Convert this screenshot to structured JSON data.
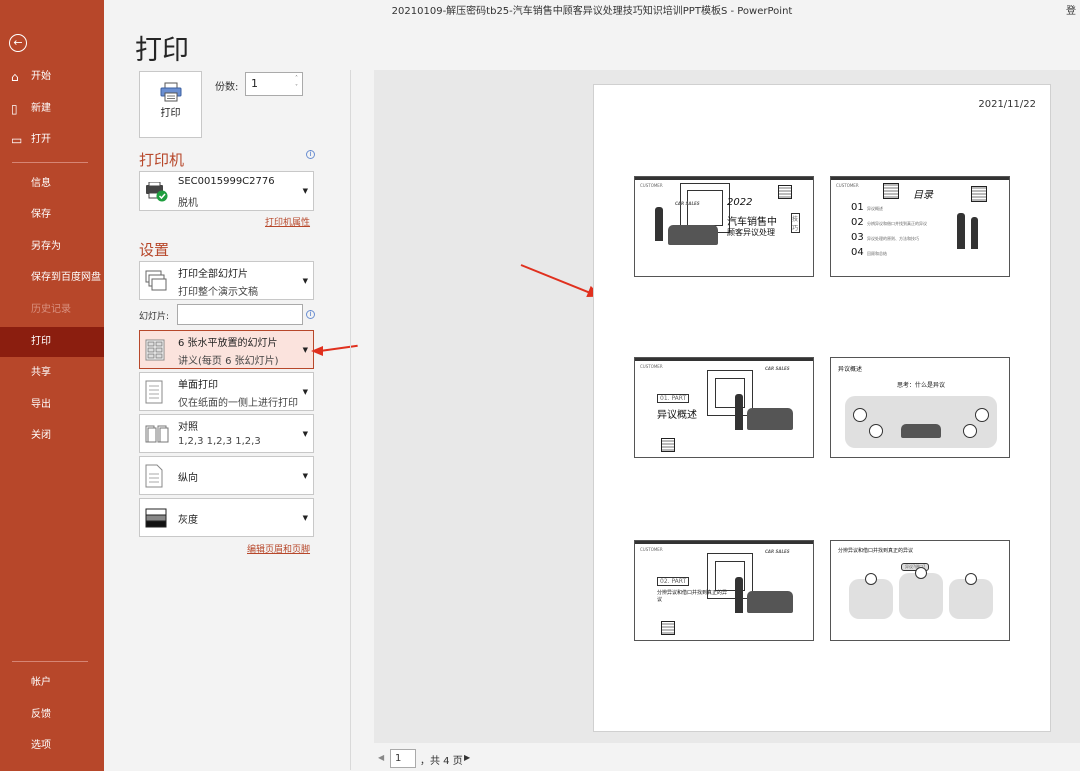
{
  "titlebar": {
    "title": "20210109-解压密码tb25-汽车销售中顾客异议处理技巧知识培训PPT模板S  -  PowerPoint",
    "signin": "登"
  },
  "sidebar": {
    "back_icon": "back-arrow-icon",
    "items": [
      {
        "label": "开始",
        "icon": "home-icon"
      },
      {
        "label": "新建",
        "icon": "new-doc-icon"
      },
      {
        "label": "打开",
        "icon": "open-folder-icon"
      },
      {
        "label": "信息"
      },
      {
        "label": "保存"
      },
      {
        "label": "另存为"
      },
      {
        "label": "保存到百度网盘"
      },
      {
        "label": "历史记录"
      },
      {
        "label": "打印"
      },
      {
        "label": "共享"
      },
      {
        "label": "导出"
      },
      {
        "label": "关闭"
      },
      {
        "label": "帐户"
      },
      {
        "label": "反馈"
      },
      {
        "label": "选项"
      }
    ],
    "active": "打印"
  },
  "page_title": "打印",
  "print_button": {
    "label": "打印"
  },
  "copies": {
    "label": "份数:",
    "value": "1"
  },
  "printer": {
    "heading": "打印机",
    "name": "SEC0015999C2776",
    "status": "脱机",
    "properties_link": "打印机属性"
  },
  "settings": {
    "heading": "设置",
    "slides_range": {
      "line1": "打印全部幻灯片",
      "line2": "打印整个演示文稿"
    },
    "slides_label": "幻灯片:",
    "slides_value": "",
    "layout": {
      "line1": "6 张水平放置的幻灯片",
      "line2": "讲义(每页 6 张幻灯片)"
    },
    "sides": {
      "line1": "单面打印",
      "line2": "仅在纸面的一侧上进行打印"
    },
    "collate": {
      "line1": "对照",
      "line2": "1,2,3    1,2,3    1,2,3"
    },
    "orientation": {
      "line1": "纵向"
    },
    "color": {
      "line1": "灰度"
    },
    "edit_header_footer_link": "编辑页眉和页脚"
  },
  "preview": {
    "date": "2021/11/22",
    "thumbs": [
      {
        "tag": "CUSTOMER",
        "title": "汽车销售中",
        "subtitle": "顾客异议处理",
        "year": "2022",
        "brand": "CAR SALES",
        "side": "技巧"
      },
      {
        "tag": "CUSTOMER",
        "title": "目录",
        "items": [
          "01",
          "02",
          "03",
          "04"
        ],
        "texts": [
          "异议概述",
          "分辨异议和借口并找到真正的异议",
          "异议处理的原则、方法和技巧",
          "回顾和总结"
        ]
      },
      {
        "tag": "CUSTOMER",
        "brand": "CAR SALES",
        "part": "01. PART",
        "title": "异议概述"
      },
      {
        "heading": "异议概述",
        "quote": "思考：什么是异议"
      },
      {
        "tag": "CUSTOMER",
        "brand": "CAR SALES",
        "part": "02. PART",
        "title": "分辨异议和借口并找到真正的异议"
      },
      {
        "heading": "分辨异议和借口并找到真正的异议",
        "btn": "异议?借口?"
      }
    ]
  },
  "pager": {
    "current": "1",
    "total": "，共 4 页"
  },
  "colors": {
    "accent": "#b7472a",
    "active": "#8b1e0f",
    "annotation": "#e0301e"
  }
}
